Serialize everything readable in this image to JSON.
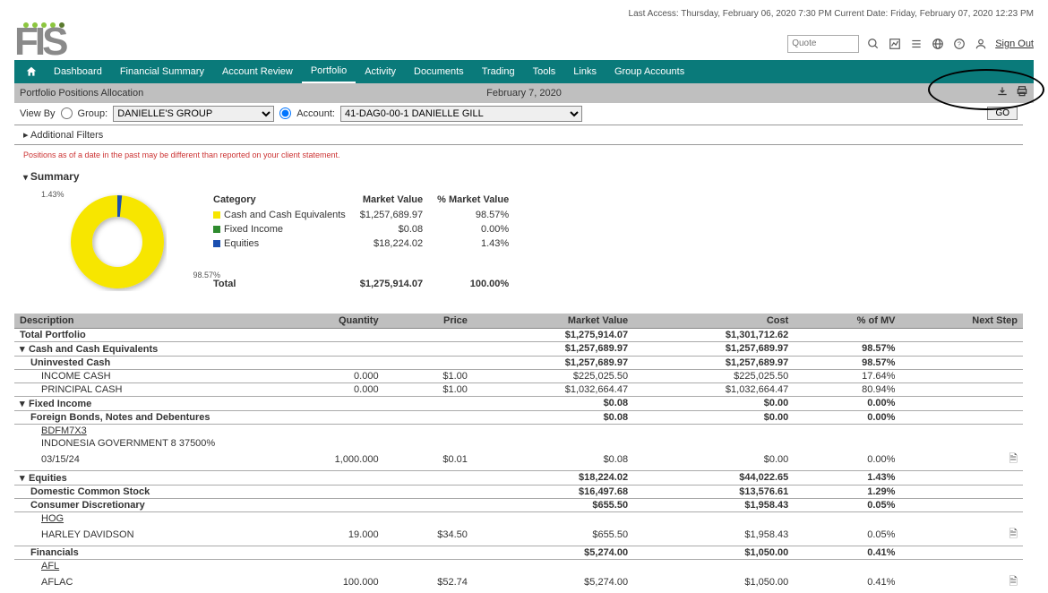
{
  "meta": {
    "top_line": "Last Access: Thursday, February 06, 2020 7:30 PM Current Date: Friday, February 07, 2020 12:23 PM"
  },
  "header": {
    "logo_text": "FIS",
    "quote_placeholder": "Quote",
    "signout": "Sign Out"
  },
  "nav": {
    "items": [
      "Dashboard",
      "Financial Summary",
      "Account Review",
      "Portfolio",
      "Activity",
      "Documents",
      "Trading",
      "Tools",
      "Links",
      "Group Accounts"
    ],
    "active_index": 3
  },
  "subheader": {
    "title": "Portfolio Positions Allocation",
    "date": "February 7, 2020"
  },
  "filters": {
    "view_by": "View By",
    "group_label": "Group:",
    "group_value": "DANIELLE'S GROUP",
    "account_label": "Account:",
    "account_value": "41-DAG0-00-1 DANIELLE GILL",
    "go": "GO",
    "additional": "Additional Filters"
  },
  "disclaimer": "Positions as of a date in the past may be different than reported on your client statement.",
  "summary": {
    "title": "Summary",
    "donut_left": "1.43%",
    "donut_right": "98.57%",
    "columns": [
      "Category",
      "Market Value",
      "% Market Value"
    ],
    "rows": [
      {
        "swatch": "#f7e600",
        "label": "Cash and Cash Equivalents",
        "mv": "$1,257,689.97",
        "pct": "98.57%"
      },
      {
        "swatch": "#2e8b2e",
        "label": "Fixed Income",
        "mv": "$0.08",
        "pct": "0.00%"
      },
      {
        "swatch": "#1a4fb0",
        "label": "Equities",
        "mv": "$18,224.02",
        "pct": "1.43%"
      }
    ],
    "total_label": "Total",
    "total_mv": "$1,275,914.07",
    "total_pct": "100.00%"
  },
  "positions": {
    "columns": [
      "Description",
      "Quantity",
      "Price",
      "Market Value",
      "Cost",
      "% of MV",
      "Next Step"
    ],
    "rows": [
      {
        "type": "bold",
        "desc": "Total Portfolio",
        "mv": "$1,275,914.07",
        "cost": "$1,301,712.62"
      },
      {
        "type": "cat",
        "exp": "▾",
        "desc": "Cash and Cash Equivalents",
        "mv": "$1,257,689.97",
        "cost": "$1,257,689.97",
        "pmv": "98.57%"
      },
      {
        "type": "bold",
        "indent": 1,
        "desc": "Uninvested Cash",
        "mv": "$1,257,689.97",
        "cost": "$1,257,689.97",
        "pmv": "98.57%"
      },
      {
        "indent": 2,
        "desc": "INCOME CASH",
        "qty": "0.000",
        "price": "$1.00",
        "mv": "$225,025.50",
        "cost": "$225,025.50",
        "pmv": "17.64%"
      },
      {
        "indent": 2,
        "desc": "PRINCIPAL CASH",
        "qty": "0.000",
        "price": "$1.00",
        "mv": "$1,032,664.47",
        "cost": "$1,032,664.47",
        "pmv": "80.94%"
      },
      {
        "type": "cat",
        "exp": "▾",
        "desc": "Fixed Income",
        "mv": "$0.08",
        "cost": "$0.00",
        "pmv": "0.00%"
      },
      {
        "type": "bold",
        "indent": 1,
        "desc": "Foreign Bonds, Notes and Debentures",
        "mv": "$0.08",
        "cost": "$0.00",
        "pmv": "0.00%"
      },
      {
        "type": "sec",
        "indent": 3,
        "desc": "BDFM7X3",
        "noborder": true
      },
      {
        "indent": "3b",
        "desc": "INDONESIA GOVERNMENT 8 37500%",
        "noborder": true
      },
      {
        "indent": "3b",
        "desc": "03/15/24",
        "qty": "1,000.000",
        "price": "$0.01",
        "mv": "$0.08",
        "cost": "$0.00",
        "pmv": "0.00%",
        "ns": true
      },
      {
        "type": "cat",
        "exp": "▾",
        "desc": "Equities",
        "mv": "$18,224.02",
        "cost": "$44,022.65",
        "pmv": "1.43%"
      },
      {
        "type": "bold",
        "indent": 1,
        "desc": "Domestic Common Stock",
        "mv": "$16,497.68",
        "cost": "$13,576.61",
        "pmv": "1.29%"
      },
      {
        "type": "bold",
        "indent": 1,
        "desc": "Consumer Discretionary",
        "mv": "$655.50",
        "cost": "$1,958.43",
        "pmv": "0.05%"
      },
      {
        "type": "sec",
        "indent": 3,
        "desc": "HOG",
        "noborder": true
      },
      {
        "indent": "3b",
        "desc": "HARLEY DAVIDSON",
        "qty": "19.000",
        "price": "$34.50",
        "mv": "$655.50",
        "cost": "$1,958.43",
        "pmv": "0.05%",
        "ns": true
      },
      {
        "type": "bold",
        "indent": 1,
        "desc": "Financials",
        "mv": "$5,274.00",
        "cost": "$1,050.00",
        "pmv": "0.41%"
      },
      {
        "type": "sec",
        "indent": 3,
        "desc": "AFL",
        "noborder": true
      },
      {
        "indent": "3b",
        "desc": "AFLAC",
        "qty": "100.000",
        "price": "$52.74",
        "mv": "$5,274.00",
        "cost": "$1,050.00",
        "pmv": "0.41%",
        "ns": true,
        "noborder": true
      }
    ]
  },
  "chart_data": {
    "type": "pie",
    "title": "Portfolio Allocation",
    "categories": [
      "Cash and Cash Equivalents",
      "Fixed Income",
      "Equities"
    ],
    "values": [
      98.57,
      0.0,
      1.43
    ],
    "colors": [
      "#f7e600",
      "#2e8b2e",
      "#1a4fb0"
    ]
  }
}
